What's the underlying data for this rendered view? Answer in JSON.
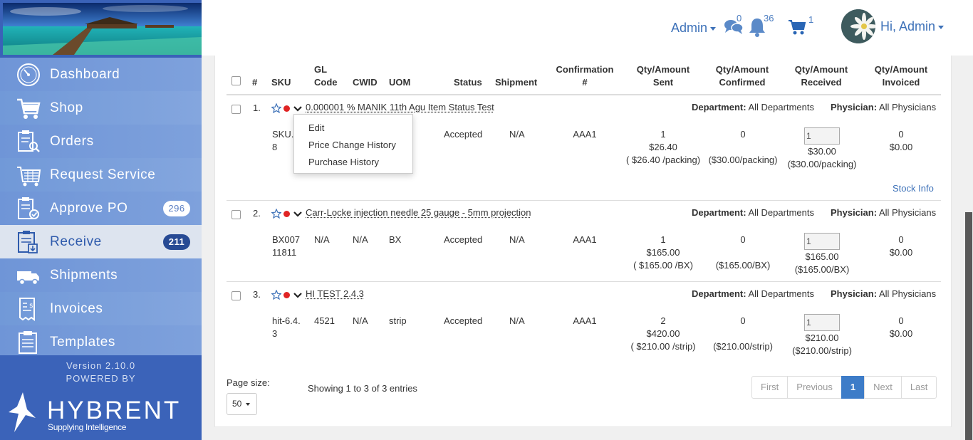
{
  "header": {
    "admin_menu": "Admin",
    "chat_count": "0",
    "notification_count": "36",
    "cart_count": "1",
    "user_greeting": "Hi, Admin"
  },
  "sidebar": {
    "items": [
      {
        "label": "Dashboard",
        "icon": "dashboard-icon"
      },
      {
        "label": "Shop",
        "icon": "cart-icon"
      },
      {
        "label": "Orders",
        "icon": "orders-icon"
      },
      {
        "label": "Request Service",
        "icon": "service-icon"
      },
      {
        "label": "Approve PO",
        "icon": "approve-icon",
        "badge": "296"
      },
      {
        "label": "Receive",
        "icon": "receive-icon",
        "badge": "211",
        "active": true
      },
      {
        "label": "Shipments",
        "icon": "truck-icon"
      },
      {
        "label": "Invoices",
        "icon": "invoice-icon"
      },
      {
        "label": "Templates",
        "icon": "template-icon"
      }
    ],
    "version": "Version 2.10.0",
    "powered_by": "POWERED BY",
    "brand_name": "HYBRENT",
    "brand_tagline": "Supplying Intelligence"
  },
  "table": {
    "headers": {
      "num": "#",
      "sku": "SKU",
      "gl_code_1": "GL",
      "gl_code_2": "Code",
      "cwid": "CWID",
      "uom": "UOM",
      "status": "Status",
      "shipment": "Shipment",
      "confirmation_1": "Confirmation",
      "confirmation_2": "#",
      "qty_sent_1": "Qty/Amount",
      "qty_sent_2": "Sent",
      "qty_confirmed_1": "Qty/Amount",
      "qty_confirmed_2": "Confirmed",
      "qty_received_1": "Qty/Amount",
      "qty_received_2": "Received",
      "qty_invoiced_1": "Qty/Amount",
      "qty_invoiced_2": "Invoiced"
    },
    "department_label": "Department:",
    "physician_label": "Physician:",
    "rows": [
      {
        "num": "1.",
        "name": "0.000001 % MANIK 11th Agu Item Status Test",
        "department": "All Departments",
        "physician": "All Physicians",
        "sku_1": "SKU.5",
        "sku_2": "8",
        "gl_code": "",
        "cwid": "",
        "uom": "",
        "status": "Accepted",
        "shipment": "N/A",
        "confirmation": "AAA1",
        "sent_qty": "1",
        "sent_amount": "$26.40",
        "sent_unit": "( $26.40 /packing)",
        "confirmed_qty": "0",
        "confirmed_unit": "($30.00/packing)",
        "received_input": "1",
        "received_amount": "$30.00",
        "received_unit": "($30.00/packing)",
        "invoiced_qty": "0",
        "invoiced_amount": "$0.00",
        "stock_info": "Stock Info"
      },
      {
        "num": "2.",
        "name": "Carr-Locke injection needle 25 gauge - 5mm projection",
        "department": "All Departments",
        "physician": "All Physicians",
        "sku_1": "BX007",
        "sku_2": "11811",
        "gl_code": "N/A",
        "cwid": "N/A",
        "uom": "BX",
        "status": "Accepted",
        "shipment": "N/A",
        "confirmation": "AAA1",
        "sent_qty": "1",
        "sent_amount": "$165.00",
        "sent_unit": "( $165.00 /BX)",
        "confirmed_qty": "0",
        "confirmed_unit": "($165.00/BX)",
        "received_input": "1",
        "received_amount": "$165.00",
        "received_unit": "($165.00/BX)",
        "invoiced_qty": "0",
        "invoiced_amount": "$0.00"
      },
      {
        "num": "3.",
        "name": "HI TEST 2.4.3",
        "department": "All Departments",
        "physician": "All Physicians",
        "sku_1": "hit-6.4.",
        "sku_2": "3",
        "gl_code": "4521",
        "cwid": "N/A",
        "uom": "strip",
        "status": "Accepted",
        "shipment": "N/A",
        "confirmation": "AAA1",
        "sent_qty": "2",
        "sent_amount": "$420.00",
        "sent_unit": "( $210.00 /strip)",
        "confirmed_qty": "0",
        "confirmed_unit": "($210.00/strip)",
        "received_input": "1",
        "received_amount": "$210.00",
        "received_unit": "($210.00/strip)",
        "invoiced_qty": "0",
        "invoiced_amount": "$0.00"
      }
    ]
  },
  "dropdown": {
    "items": [
      "Edit",
      "Price Change History",
      "Purchase History"
    ]
  },
  "footer": {
    "page_size_label": "Page size:",
    "page_size_value": "50",
    "entries_text": "Showing 1 to 3 of 3 entries",
    "pager": [
      "First",
      "Previous",
      "1",
      "Next",
      "Last"
    ]
  },
  "colors": {
    "accent": "#3d71b8",
    "sidebar": "#6f95d7",
    "sidebar_footer": "#3b63b9",
    "status_dot": "#e02424",
    "pager_active": "#3d7cc8"
  }
}
